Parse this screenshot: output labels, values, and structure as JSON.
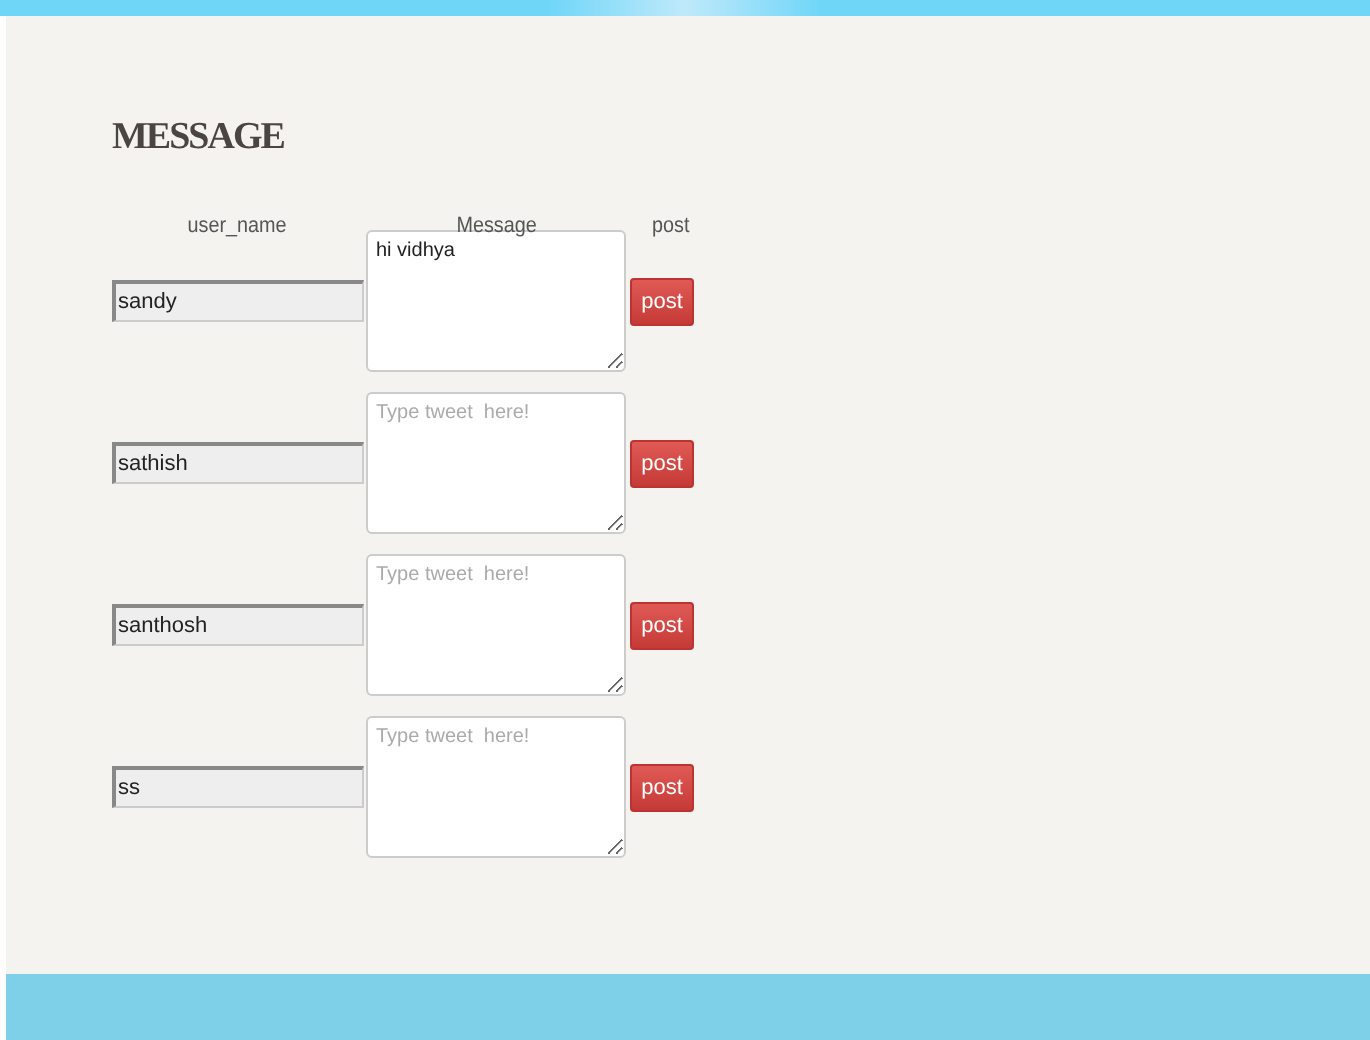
{
  "title": "MESSAGE",
  "columns": [
    "user_name",
    "Message",
    "post"
  ],
  "rows": [
    {
      "user_name": "sandy",
      "message": "hi vidhya",
      "button": "post"
    },
    {
      "user_name": "sathish",
      "placeholder": "Type tweet  here!",
      "button": "post"
    },
    {
      "user_name": "santhosh",
      "placeholder": "Type tweet  here!",
      "button": "post"
    },
    {
      "user_name": "ss",
      "placeholder": "Type tweet  here!",
      "button": "post"
    }
  ]
}
